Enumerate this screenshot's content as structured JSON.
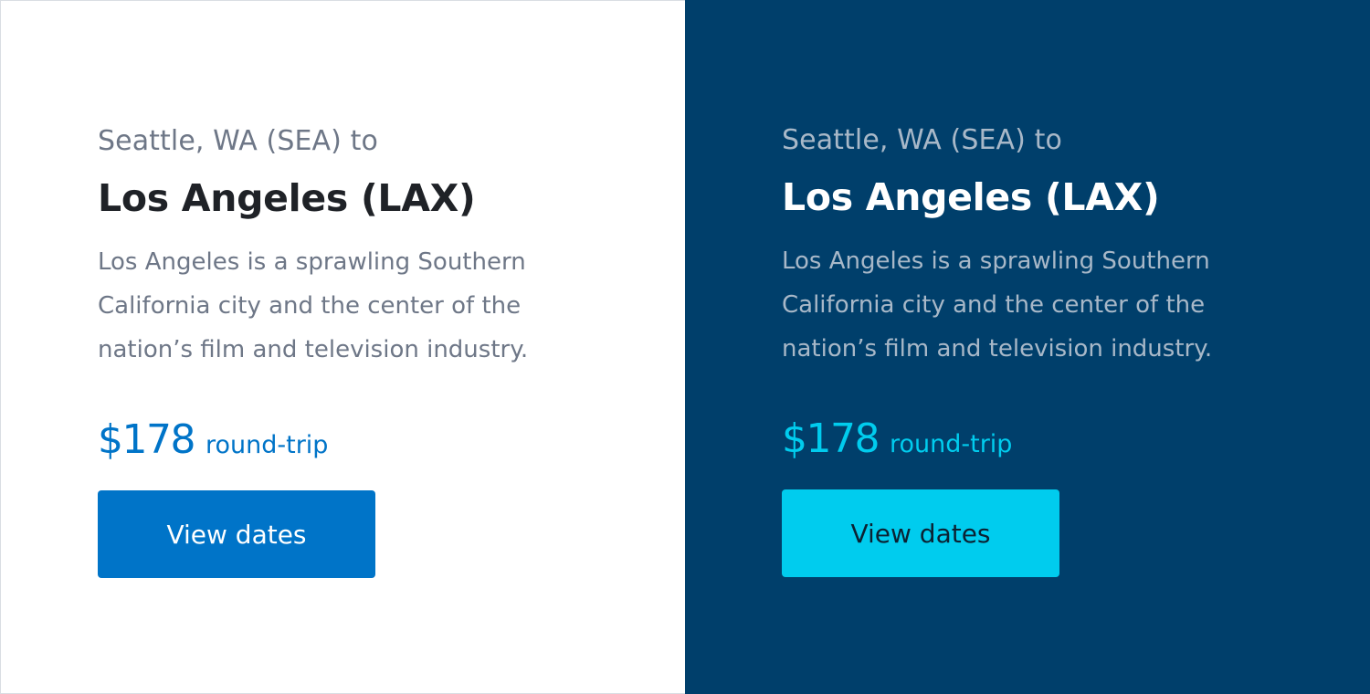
{
  "cards": [
    {
      "theme": "light",
      "origin": "Seattle, WA (SEA) to",
      "destination": "Los Angeles (LAX)",
      "description": "Los Angeles is a sprawling Southern California city and the center of the nation’s film and television industry.",
      "price": "$178",
      "trip_type": "round-trip",
      "button_label": "View dates",
      "colors": {
        "background": "#ffffff",
        "accent": "#0074c8",
        "button_text": "#ffffff"
      }
    },
    {
      "theme": "dark",
      "origin": "Seattle, WA (SEA) to",
      "destination": "Los Angeles (LAX)",
      "description": "Los Angeles is a sprawling Southern California city and the center of the nation’s film and television industry.",
      "price": "$178",
      "trip_type": "round-trip",
      "button_label": "View dates",
      "colors": {
        "background": "#003f6b",
        "accent": "#00ccee",
        "button_text": "#0b2233"
      }
    }
  ]
}
